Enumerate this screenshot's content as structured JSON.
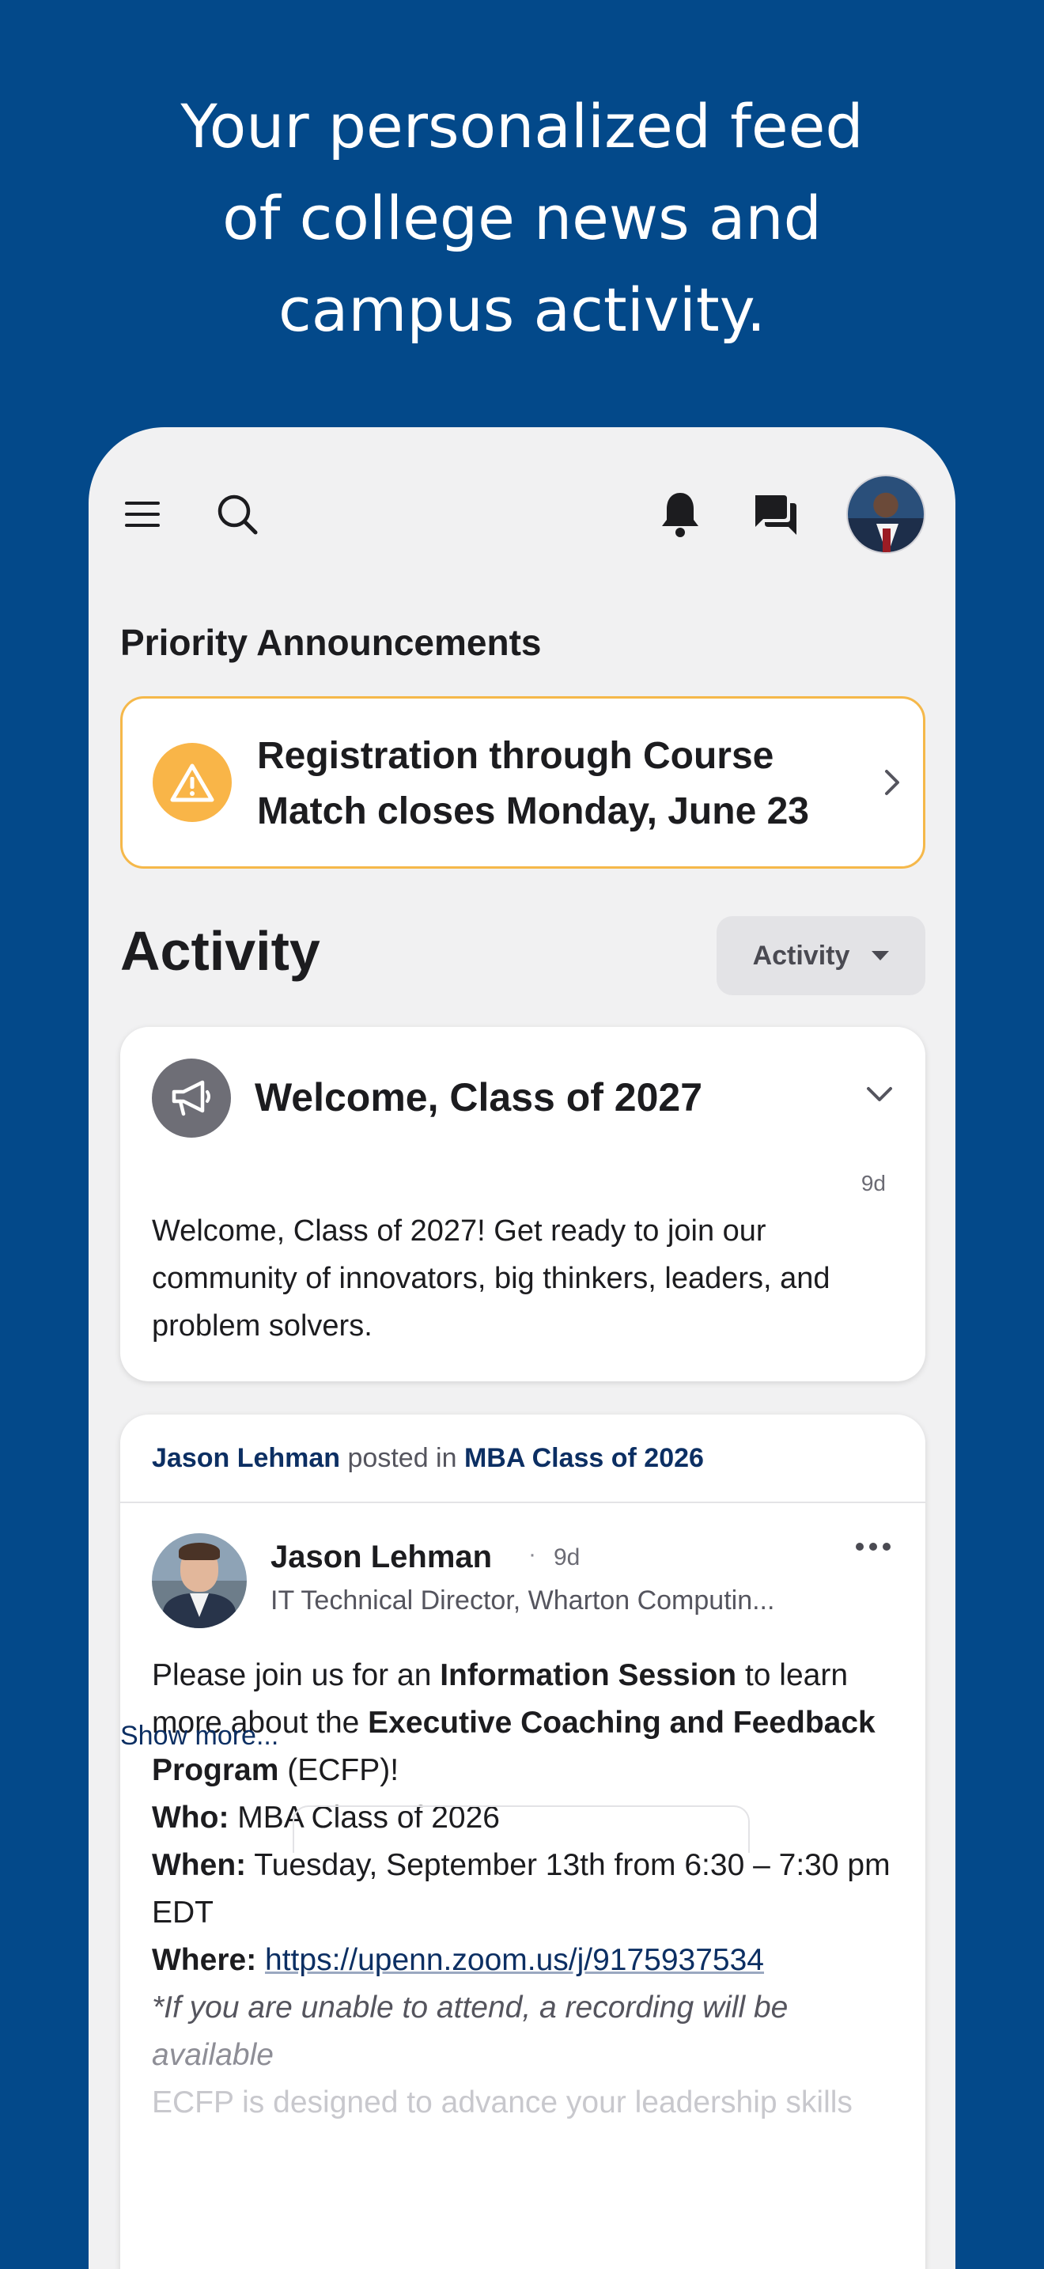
{
  "promo": {
    "headline_line1": "Your personalized feed",
    "headline_line2": "of college news and",
    "headline_line3": "campus activity."
  },
  "topbar": {
    "menu_icon": "menu-icon",
    "search_icon": "search-icon",
    "notifications_icon": "bell-icon",
    "messages_icon": "chat-icon",
    "profile_avatar": "avatar"
  },
  "priority": {
    "section_title": "Priority Announcements",
    "announcement_text": "Registration through Course Match closes Monday, June 23",
    "accent_color": "#f9b548"
  },
  "activity": {
    "title": "Activity",
    "filter_label": "Activity"
  },
  "welcome_card": {
    "title": "Welcome, Class of 2027",
    "time": "9d",
    "body": "Welcome, Class of 2027! Get ready to join our community of innovators, big thinkers, leaders, and problem solvers."
  },
  "post": {
    "context_author": "Jason Lehman",
    "context_posted_in": " posted in ",
    "context_group": "MBA Class of 2026",
    "author_name": "Jason Lehman",
    "dot": "·",
    "time": "9d",
    "author_role": "IT Technical Director, Wharton Computin...",
    "body": {
      "p1_pre": "Please join us for an ",
      "p1_bold1": "Information Session",
      "p1_mid": " to learn more about the ",
      "p1_bold2": "Executive Coaching and Feedback Program",
      "p1_post": " (ECFP)!",
      "who_label": "Who:",
      "who_value": " MBA Class of 2026",
      "when_label": "When:",
      "when_value": " Tuesday, September 13th from 6:30 – 7:30 pm EDT",
      "where_label": "Where:",
      "where_value": "https://upenn.zoom.us/j/9175937534",
      "note_line1": "*If you are unable to attend, a recording will be",
      "note_line2": "available",
      "fade_line": "ECFP is designed to advance your leadership skills"
    },
    "show_more": "Show more..."
  }
}
